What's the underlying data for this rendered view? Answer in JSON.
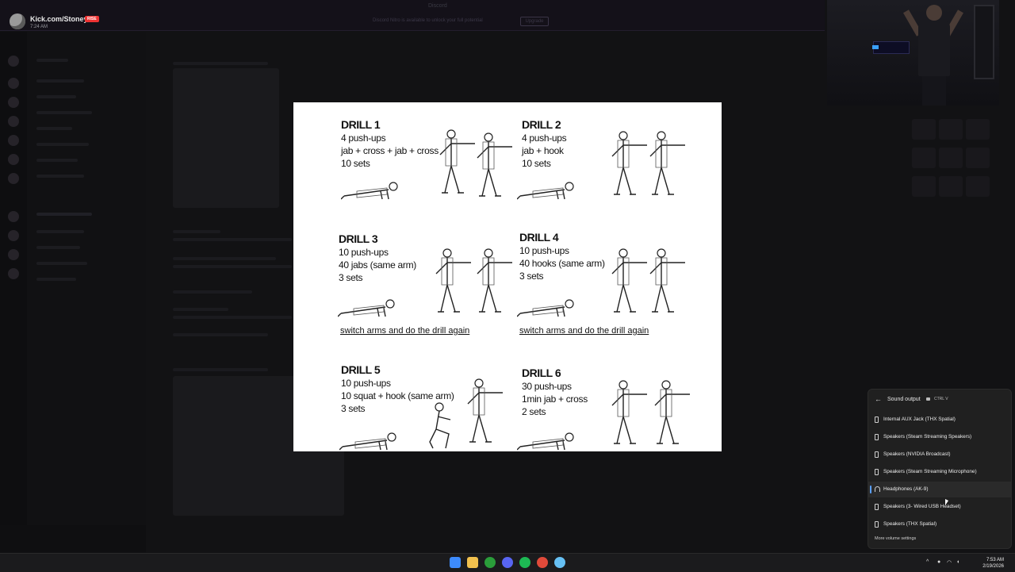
{
  "stream": {
    "title": "Kick.com/Stoney...",
    "live_badge": "RISE",
    "time": "7:24 AM"
  },
  "background_app": {
    "banner_text": "Discord Nitro is available to unlock your full potential",
    "banner_button": "Upgrade",
    "topbar_title": "Discord"
  },
  "image_viewer": {
    "drills": [
      {
        "title": "DRILL 1",
        "lines": [
          "4 push-ups",
          "jab + cross + jab + cross",
          "10 sets"
        ]
      },
      {
        "title": "DRILL 2",
        "lines": [
          "4 push-ups",
          "jab + hook",
          "10 sets"
        ]
      },
      {
        "title": "DRILL 3",
        "lines": [
          "10 push-ups",
          "40 jabs (same arm)",
          "3 sets"
        ],
        "note": "switch arms and do the drill again"
      },
      {
        "title": "DRILL 4",
        "lines": [
          "10 push-ups",
          "40 hooks (same arm)",
          "3 sets"
        ],
        "note": "switch arms and do the drill again"
      },
      {
        "title": "DRILL 5",
        "lines": [
          "10 push-ups",
          "10 squat + hook (same arm)",
          "3 sets"
        ]
      },
      {
        "title": "DRILL 6",
        "lines": [
          "30 push-ups",
          "1min jab + cross",
          "2 sets"
        ]
      }
    ]
  },
  "sound_flyout": {
    "title": "Sound output",
    "shortcut": "CTRL V",
    "devices": [
      {
        "label": "Internal AUX Jack (THX Spatial)",
        "icon": "speaker-icon",
        "active": false
      },
      {
        "label": "Speakers (Steam Streaming Speakers)",
        "icon": "speaker-icon",
        "active": false
      },
      {
        "label": "Speakers (NVIDIA Broadcast)",
        "icon": "speaker-icon",
        "active": false
      },
      {
        "label": "Speakers (Steam Streaming Microphone)",
        "icon": "speaker-icon",
        "active": false
      },
      {
        "label": "Headphones (AK-9)",
        "icon": "headphones-icon",
        "active": true
      },
      {
        "label": "Speakers (3- Wired USB Headset)",
        "icon": "speaker-icon",
        "active": false
      },
      {
        "label": "Speakers (THX Spatial)",
        "icon": "speaker-icon",
        "active": false
      }
    ],
    "more_settings": "More volume settings"
  },
  "taskbar": {
    "icons": [
      "windows-start-icon",
      "file-explorer-icon",
      "xbox-icon",
      "discord-icon",
      "spotify-icon",
      "chrome-icon",
      "steam-icon"
    ],
    "colors": {
      "start": "#3d8bfd",
      "explorer": "#f2c14e",
      "xbox": "#2a9d3a",
      "discord": "#5865f2",
      "spotify": "#1db954",
      "chrome": "#e04a3a",
      "steam": "#66c0f4"
    },
    "clock_time": "7:53 AM",
    "clock_date": "2/19/2026"
  }
}
